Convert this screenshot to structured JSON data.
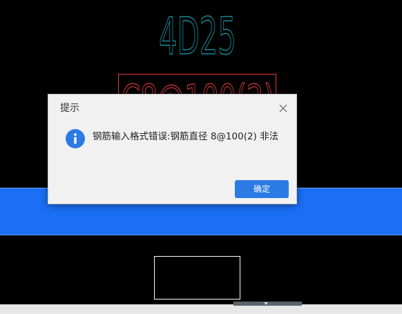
{
  "drawing": {
    "rebar_count": "4D25",
    "rebar_spec": "C8@100(2)"
  },
  "dialog": {
    "title": "提示",
    "message": "钢筋输入格式错误:钢筋直径 8@100(2) 非法",
    "ok_label": "确定",
    "icon": "info-icon",
    "close_icon": "close-icon"
  },
  "colors": {
    "canvas_bg": "#000000",
    "rebar_count_text": "#1aa7b5",
    "rebar_spec_text": "#e23b3b",
    "highlight_band": "#1a6ff5",
    "ok_button": "#2c7be5",
    "info_icon": "#2c7be5"
  }
}
